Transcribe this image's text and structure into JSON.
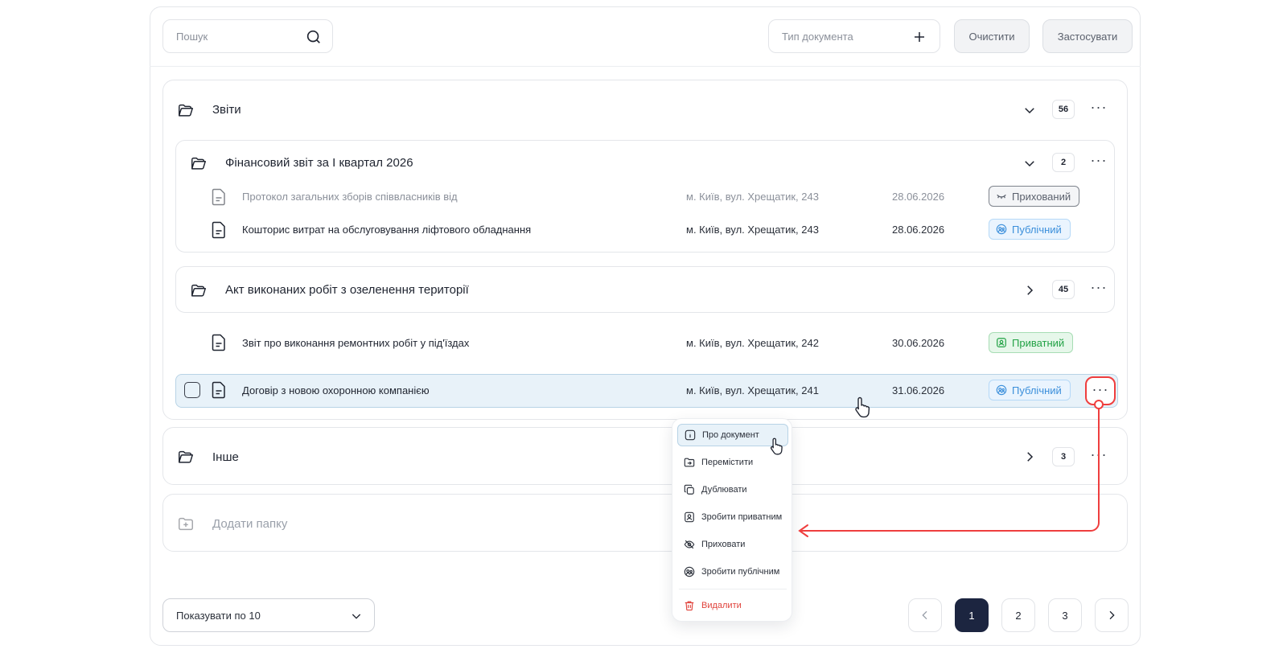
{
  "toolbar": {
    "search_placeholder": "Пошук",
    "doc_type_placeholder": "Тип документа",
    "clear_label": "Очистити",
    "apply_label": "Застосувати"
  },
  "folders": [
    {
      "title": "Звіти",
      "count": "56",
      "expanded": true
    },
    {
      "title": "Фінансовий звіт за І квартал 2026",
      "count": "2",
      "expanded": true
    },
    {
      "title": "Акт виконаних робіт з озеленення території",
      "count": "45",
      "expanded": false
    },
    {
      "title": "Інше",
      "count": "3",
      "expanded": false
    }
  ],
  "add_folder_label": "Додати папку",
  "documents": [
    {
      "name": "Протокол загальних зборів співвласників від",
      "address": "м. Київ, вул. Хрещатик, 243",
      "date": "28.06.2026",
      "status": "Прихований",
      "dimmed": true
    },
    {
      "name": "Кошторис витрат на обслуговування ліфтового обладнання",
      "address": "м. Київ, вул. Хрещатик, 243",
      "date": "28.06.2026",
      "status": "Публічний"
    },
    {
      "name": "Звіт про виконання ремонтних робіт у під'їздах",
      "address": "м. Київ, вул. Хрещатик, 242",
      "date": "30.06.2026",
      "status": "Приватний"
    },
    {
      "name": "Договір з новою охоронною компанією",
      "address": "м. Київ, вул. Хрещатик, 241",
      "date": "31.06.2026",
      "status": "Публічний",
      "selected": true
    }
  ],
  "context_menu": {
    "items": [
      {
        "label": "Про документ",
        "icon": "info-icon"
      },
      {
        "label": "Перемістити",
        "icon": "move-icon"
      },
      {
        "label": "Дублювати",
        "icon": "duplicate-icon"
      },
      {
        "label": "Зробити приватним",
        "icon": "private-icon"
      },
      {
        "label": "Приховати",
        "icon": "eye-off-icon"
      },
      {
        "label": "Зробити публічним",
        "icon": "public-icon"
      },
      {
        "label": "Видалити",
        "icon": "trash-icon"
      }
    ]
  },
  "pagination": {
    "per_page_label": "Показувати по 10",
    "pages": [
      "1",
      "2",
      "3"
    ],
    "current": "1"
  },
  "colors": {
    "accent_dark": "#1c2540",
    "public": "#3b8fdb",
    "private": "#22a245",
    "danger": "#e0433c",
    "annotation": "#ef3e3e"
  }
}
